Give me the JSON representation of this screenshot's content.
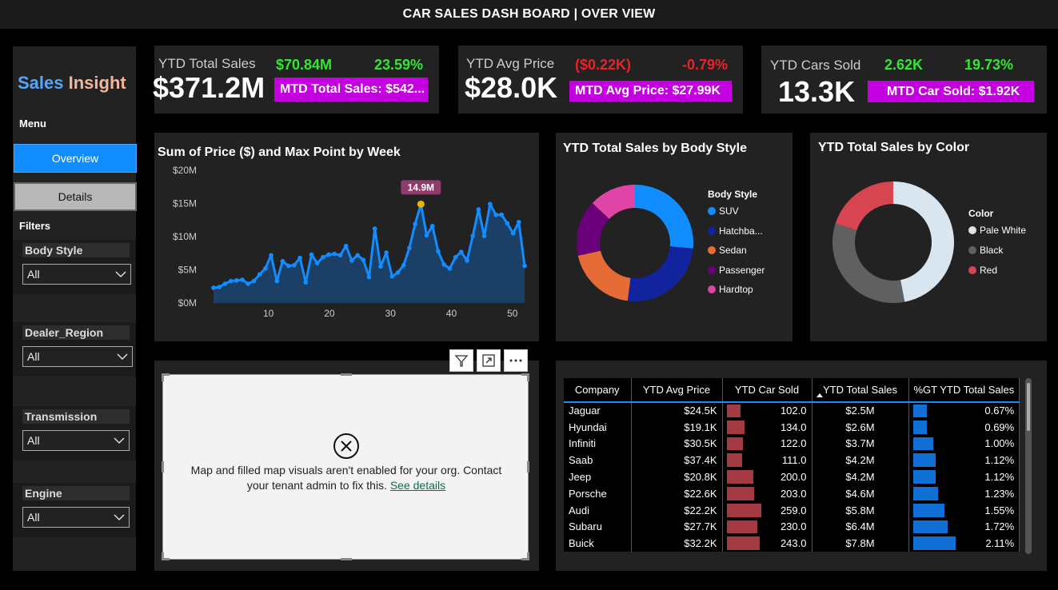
{
  "header": {
    "title": "CAR SALES DASH BOARD | OVER VIEW"
  },
  "sidebar": {
    "logo_part1": "Sales",
    "logo_part2": "Insight",
    "menu_label": "Menu",
    "nav": {
      "overview": "Overview",
      "details": "Details"
    },
    "filters_label": "Filters",
    "slicers": [
      {
        "title": "Body Style",
        "value": "All"
      },
      {
        "title": "Dealer_Region",
        "value": "All"
      },
      {
        "title": "Transmission",
        "value": "All"
      },
      {
        "title": "Engine",
        "value": "All"
      }
    ]
  },
  "kpis": {
    "sales": {
      "label": "YTD Total Sales",
      "value": "$371.2M",
      "change": "$70.84M",
      "pct": "23.59%",
      "mtd": "MTD Total Sales: $542..."
    },
    "price": {
      "label": "YTD Avg Price",
      "value": "$28.0K",
      "change": "($0.22K)",
      "pct": "-0.79%",
      "mtd": "MTD Avg Price: $27.99K"
    },
    "cars": {
      "label": "YTD Cars Sold",
      "value": "13.3K",
      "change": "2.62K",
      "pct": "19.73%",
      "mtd": "MTD Car Sold: $1.92K"
    }
  },
  "line_card": {
    "title": "Sum of Price ($) and Max Point by Week",
    "peak_label": "14.9M"
  },
  "body_card": {
    "title": "YTD Total Sales by Body Style",
    "legend_title": "Body Style"
  },
  "color_card": {
    "title": "YTD Total Sales by Color",
    "legend_title": "Color"
  },
  "map": {
    "message_line1": "Map and filled map visuals aren't enabled for your org. Contact",
    "message_line2": "your tenant admin to fix this.",
    "link": "See details"
  },
  "table": {
    "columns": [
      "Company",
      "YTD Avg Price",
      "YTD Car Sold",
      "YTD Total Sales",
      "%GT YTD Total Sales"
    ],
    "rows": [
      {
        "company": "Jaguar",
        "avg_price": "$24.5K",
        "sold": "102.0",
        "sold_val": 102,
        "sales": "$2.5M",
        "pct": "0.67%",
        "pct_val": 0.67
      },
      {
        "company": "Hyundai",
        "avg_price": "$19.1K",
        "sold": "134.0",
        "sold_val": 134,
        "sales": "$2.6M",
        "pct": "0.69%",
        "pct_val": 0.69
      },
      {
        "company": "Infiniti",
        "avg_price": "$30.5K",
        "sold": "122.0",
        "sold_val": 122,
        "sales": "$3.7M",
        "pct": "1.00%",
        "pct_val": 1.0
      },
      {
        "company": "Saab",
        "avg_price": "$37.4K",
        "sold": "111.0",
        "sold_val": 111,
        "sales": "$4.2M",
        "pct": "1.12%",
        "pct_val": 1.12
      },
      {
        "company": "Jeep",
        "avg_price": "$20.8K",
        "sold": "200.0",
        "sold_val": 200,
        "sales": "$4.2M",
        "pct": "1.12%",
        "pct_val": 1.12
      },
      {
        "company": "Porsche",
        "avg_price": "$22.6K",
        "sold": "203.0",
        "sold_val": 203,
        "sales": "$4.6M",
        "pct": "1.23%",
        "pct_val": 1.23
      },
      {
        "company": "Audi",
        "avg_price": "$22.2K",
        "sold": "259.0",
        "sold_val": 259,
        "sales": "$5.8M",
        "pct": "1.55%",
        "pct_val": 1.55
      },
      {
        "company": "Subaru",
        "avg_price": "$27.7K",
        "sold": "230.0",
        "sold_val": 230,
        "sales": "$6.4M",
        "pct": "1.72%",
        "pct_val": 1.72
      },
      {
        "company": "Buick",
        "avg_price": "$32.2K",
        "sold": "243.0",
        "sold_val": 243,
        "sales": "$7.8M",
        "pct": "2.11%",
        "pct_val": 2.11
      }
    ]
  },
  "colors": {
    "accent": "#118dff",
    "mtd_badge": "#c400e0",
    "positive": "#33e633",
    "negative": "#e8222b",
    "bar_red": "#a33a41",
    "bar_blue": "#1170d6"
  },
  "chart_data": [
    {
      "type": "area",
      "title": "Sum of Price ($) and Max Point by Week",
      "xlabel": "",
      "ylabel": "",
      "x": [
        1,
        2,
        3,
        4,
        5,
        6,
        7,
        8,
        9,
        10,
        11,
        12,
        13,
        14,
        15,
        16,
        17,
        18,
        19,
        20,
        21,
        22,
        23,
        24,
        25,
        26,
        27,
        28,
        29,
        30,
        31,
        32,
        33,
        34,
        35,
        36,
        37,
        38,
        39,
        40,
        41,
        42,
        43,
        44,
        45,
        46,
        47,
        48,
        49,
        50,
        51,
        52
      ],
      "values": [
        2.3,
        2.4,
        2.9,
        3.3,
        3.4,
        3.5,
        2.9,
        3.3,
        4.3,
        5.2,
        7.2,
        3.3,
        6.3,
        5.6,
        5.7,
        6.8,
        3.1,
        7.3,
        6.0,
        6.9,
        7.3,
        7.4,
        7.2,
        8.6,
        6.4,
        7.2,
        6.5,
        3.9,
        11.2,
        5.5,
        7.6,
        4.0,
        4.6,
        5.7,
        8.3,
        11.9,
        14.9,
        10.2,
        11.6,
        7.8,
        5.8,
        5.2,
        6.9,
        7.7,
        6.4,
        10.1,
        14.1,
        10.1,
        14.9,
        13.3,
        13.3,
        12.0,
        10.5,
        12.2,
        5.6
      ],
      "peak": {
        "week": 36,
        "value": 14.9
      },
      "xticks": [
        10,
        20,
        30,
        40,
        50
      ],
      "ytick_labels": [
        "$0M",
        "$5M",
        "$10M",
        "$15M",
        "$20M"
      ],
      "ylim": [
        0,
        20
      ],
      "grid": false
    },
    {
      "type": "pie",
      "title": "YTD Total Sales by Body Style",
      "legend_title": "Body Style",
      "categories": [
        "SUV",
        "Hatchback",
        "Sedan",
        "Passenger",
        "Hardtop"
      ],
      "legend_labels": [
        "SUV",
        "Hatchba...",
        "Sedan",
        "Passenger",
        "Hardtop"
      ],
      "values": [
        26.5,
        25.5,
        19.5,
        15.5,
        13.0
      ],
      "colors": [
        "#118dff",
        "#12239e",
        "#e66c37",
        "#6b007b",
        "#e044a7"
      ],
      "legend": "right"
    },
    {
      "type": "pie",
      "title": "YTD Total Sales by Color",
      "legend_title": "Color",
      "categories": [
        "Pale White",
        "Black",
        "Red"
      ],
      "values": [
        47,
        33,
        20
      ],
      "colors": [
        "#d9e6f0",
        "#606060",
        "#d64550"
      ],
      "legend": "right"
    }
  ]
}
